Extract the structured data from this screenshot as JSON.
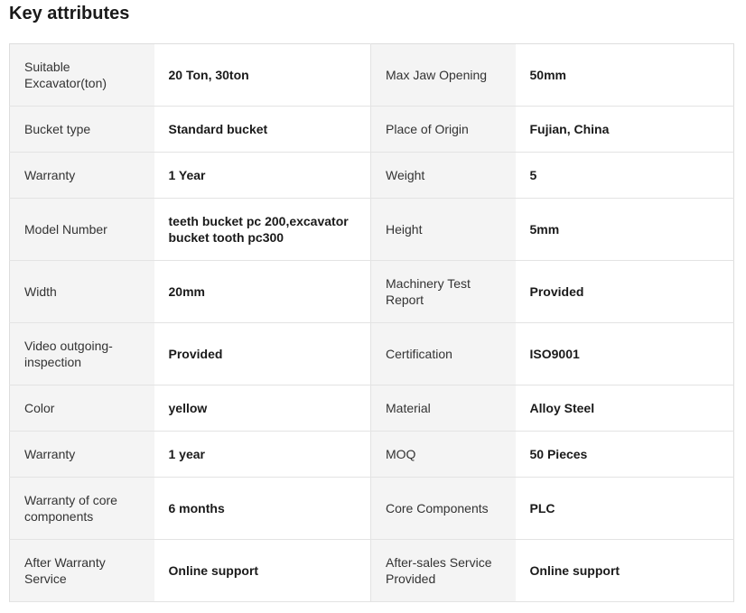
{
  "section": {
    "title": "Key attributes"
  },
  "rows": [
    {
      "label1": "Suitable Excavator(ton)",
      "value1": "20 Ton, 30ton",
      "label2": "Max Jaw Opening",
      "value2": "50mm"
    },
    {
      "label1": "Bucket type",
      "value1": "Standard bucket",
      "label2": "Place of Origin",
      "value2": "Fujian, China"
    },
    {
      "label1": "Warranty",
      "value1": "1 Year",
      "label2": "Weight",
      "value2": "5"
    },
    {
      "label1": "Model Number",
      "value1": "teeth bucket pc 200,excavator bucket tooth pc300",
      "label2": "Height",
      "value2": "5mm"
    },
    {
      "label1": "Width",
      "value1": "20mm",
      "label2": "Machinery Test Report",
      "value2": "Provided"
    },
    {
      "label1": "Video outgoing-inspection",
      "value1": "Provided",
      "label2": "Certification",
      "value2": "ISO9001"
    },
    {
      "label1": "Color",
      "value1": "yellow",
      "label2": "Material",
      "value2": "Alloy Steel"
    },
    {
      "label1": "Warranty",
      "value1": "1 year",
      "label2": "MOQ",
      "value2": "50 Pieces"
    },
    {
      "label1": "Warranty of core components",
      "value1": "6 months",
      "label2": "Core Components",
      "value2": "PLC"
    },
    {
      "label1": "After Warranty Service",
      "value1": "Online support",
      "label2": "After-sales Service Provided",
      "value2": "Online support"
    }
  ]
}
